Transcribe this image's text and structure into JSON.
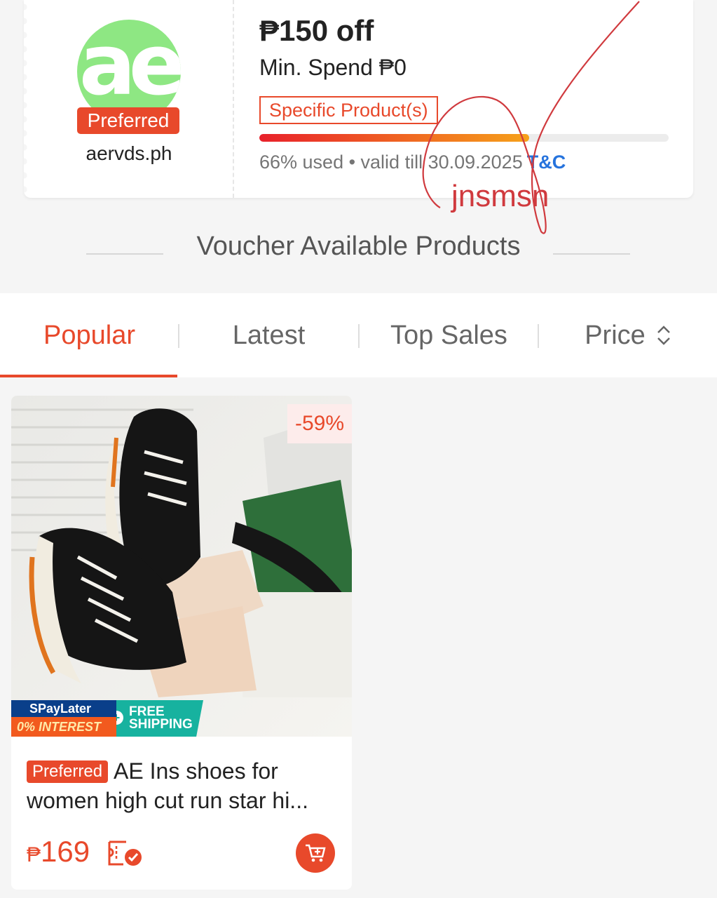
{
  "voucher": {
    "logo_text": "ae",
    "badge": "Preferred",
    "shop_name": "aervds.ph",
    "title": "₱150 off",
    "min_spend": "Min. Spend ₱0",
    "tag": "Specific Product(s)",
    "usage_percent": 66,
    "usage_text": "66% used • valid till 30.09.2025",
    "tc_label": "T&C"
  },
  "annotation": {
    "scribble": "jnsmsn",
    "color": "#d03a3e"
  },
  "section": {
    "heading": "Voucher Available Products"
  },
  "tabs": [
    {
      "label": "Popular",
      "active": true
    },
    {
      "label": "Latest",
      "active": false
    },
    {
      "label": "Top Sales",
      "active": false
    },
    {
      "label": "Price",
      "active": false,
      "icon": "sort-arrows-icon"
    }
  ],
  "product": {
    "discount": "-59%",
    "spaylater_top": "SPayLater",
    "spaylater_bottom": "0% INTEREST",
    "free_shipping_1": "FREE",
    "free_shipping_2": "SHIPPING",
    "badge": "Preferred",
    "title_line1": "AE Ins shoes for",
    "title_line2": "women high cut run star hi...",
    "currency": "₱",
    "price": "169"
  },
  "colors": {
    "accent": "#e8492b",
    "link": "#2673dd",
    "logo_green": "#8ee783"
  }
}
